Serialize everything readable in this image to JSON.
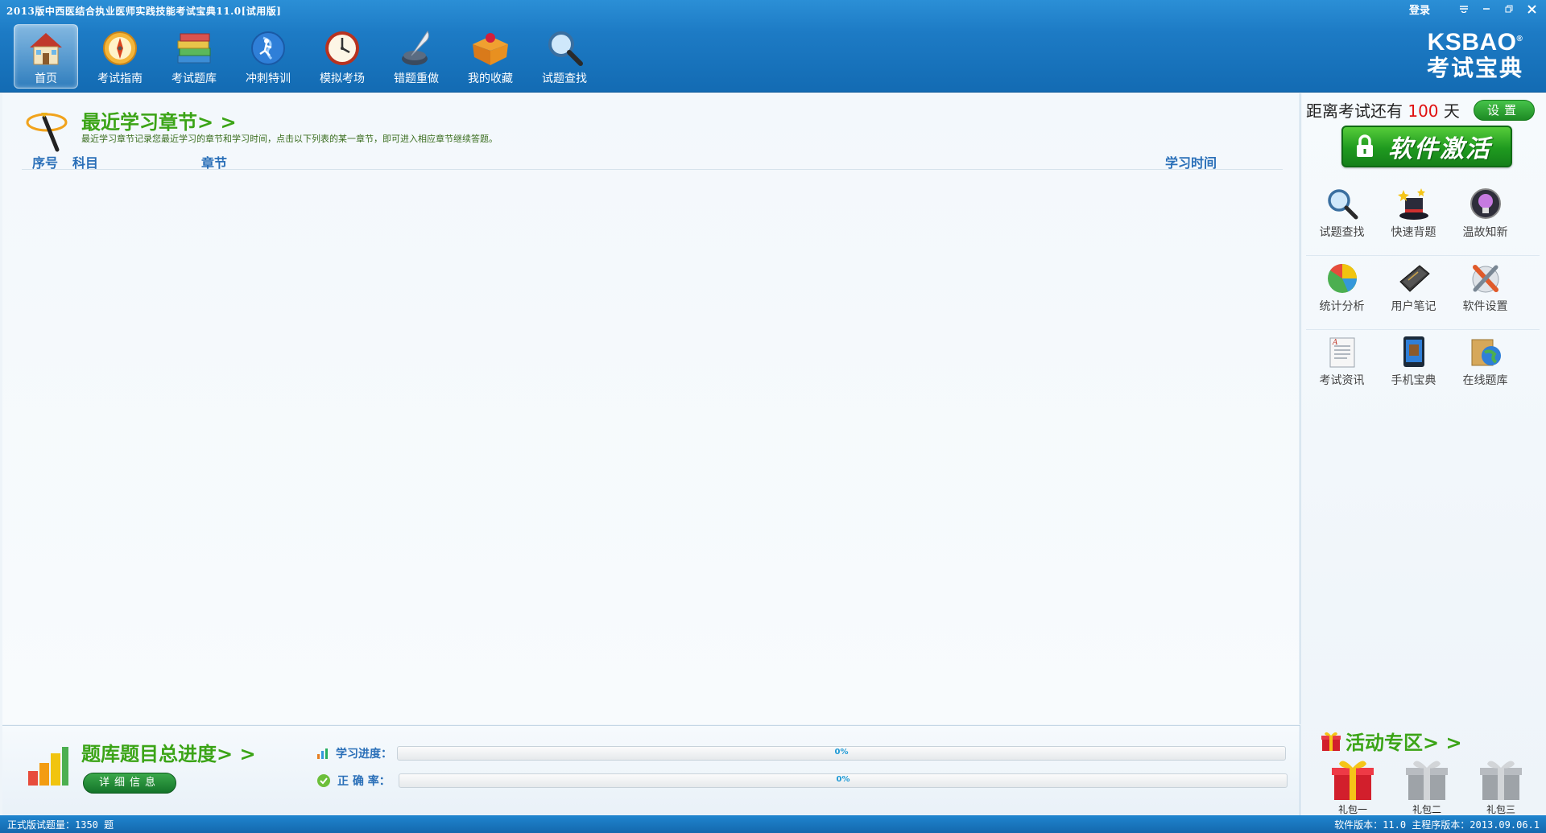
{
  "window": {
    "title": "2013版中西医结合执业医师实践技能考试宝典11.0[试用版]",
    "login": "登录",
    "controls": {
      "menu": "≡",
      "minimize": "–",
      "restore": "⧉",
      "close": "✕"
    }
  },
  "toolbar": [
    {
      "label": "首页",
      "icon": "home-icon",
      "active": true
    },
    {
      "label": "考试指南",
      "icon": "compass-icon",
      "active": false
    },
    {
      "label": "考试题库",
      "icon": "books-icon",
      "active": false
    },
    {
      "label": "冲刺特训",
      "icon": "runner-globe-icon",
      "active": false
    },
    {
      "label": "模拟考场",
      "icon": "clock-icon",
      "active": false
    },
    {
      "label": "错题重做",
      "icon": "quill-icon",
      "active": false
    },
    {
      "label": "我的收藏",
      "icon": "treasure-box-icon",
      "active": false
    },
    {
      "label": "试题查找",
      "icon": "magnifier-icon",
      "active": false
    }
  ],
  "brand": {
    "name": "KSBAO",
    "reg": "®",
    "sub": "考试宝典"
  },
  "recent": {
    "title": "最近学习章节> >",
    "description": "最近学习章节记录您最近学习的章节和学习时间，点击以下列表的某一章节，即可进入相应章节继续答题。",
    "columns": {
      "index": "序号",
      "subject": "科目",
      "chapter": "章节",
      "time": "学习时间"
    }
  },
  "progress": {
    "title": "题库题目总进度> >",
    "detail_button": "详细信息",
    "study_label": "学习进度：",
    "study_value": "0%",
    "study_fraction": 0,
    "accuracy_label": "正 确 率：",
    "accuracy_value": "0%",
    "accuracy_fraction": 0
  },
  "sidebar": {
    "countdown_prefix": "距离考试还有",
    "countdown_days": "100",
    "countdown_suffix": "天",
    "settings_button": "设置",
    "activate_button": "软件激活",
    "grid": [
      [
        {
          "label": "试题查找",
          "icon": "magnifier-icon"
        },
        {
          "label": "快速背题",
          "icon": "magic-hat-icon"
        },
        {
          "label": "温故知新",
          "icon": "lightbulb-icon"
        }
      ],
      [
        {
          "label": "统计分析",
          "icon": "pie-chart-icon"
        },
        {
          "label": "用户笔记",
          "icon": "notebook-icon"
        },
        {
          "label": "软件设置",
          "icon": "tools-icon"
        }
      ],
      [
        {
          "label": "考试资讯",
          "icon": "document-icon"
        },
        {
          "label": "手机宝典",
          "icon": "phone-icon"
        },
        {
          "label": "在线题库",
          "icon": "globe-folder-icon"
        }
      ]
    ],
    "events_title": "活动专区> >",
    "gifts": [
      {
        "label": "礼包一",
        "icon": "gift-red-icon"
      },
      {
        "label": "礼包二",
        "icon": "gift-grey-icon"
      },
      {
        "label": "礼包三",
        "icon": "gift-grey-icon"
      }
    ]
  },
  "status": {
    "left": "正式版试题量：1350 题",
    "right": "软件版本：11.0 主程序版本：2013.09.06.1"
  },
  "colors": {
    "header_blue": "#1d7bc5",
    "title_green": "#3ba416",
    "link_blue": "#2a6fb8",
    "countdown_red": "#e01010"
  }
}
